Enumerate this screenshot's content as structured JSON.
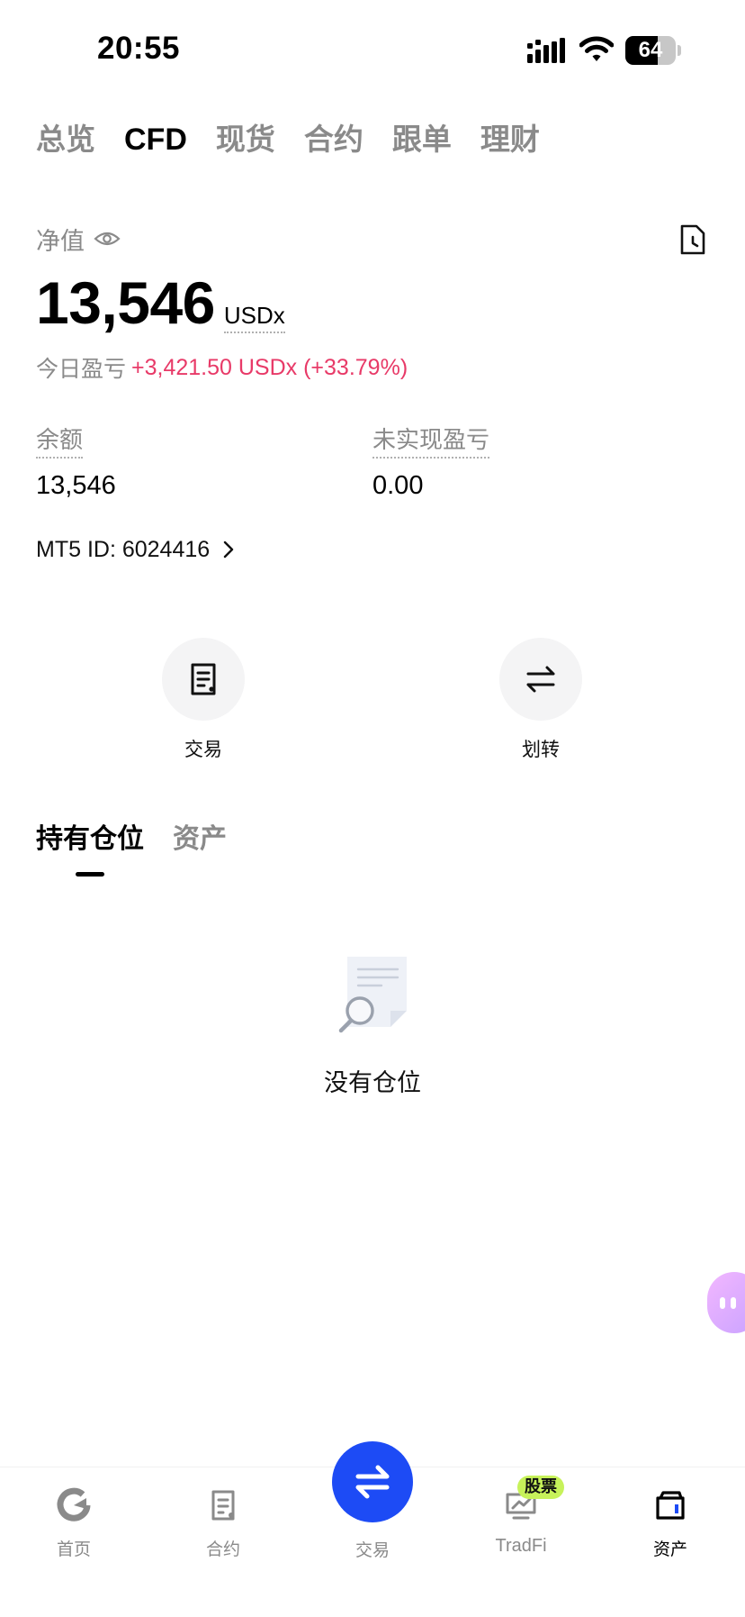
{
  "status_bar": {
    "time": "20:55",
    "battery": "64",
    "battery_level": 0.64
  },
  "top_tabs": [
    {
      "label": "总览",
      "active": false
    },
    {
      "label": "CFD",
      "active": true
    },
    {
      "label": "现货",
      "active": false
    },
    {
      "label": "合约",
      "active": false
    },
    {
      "label": "跟单",
      "active": false
    },
    {
      "label": "理财",
      "active": false
    }
  ],
  "overview": {
    "net_label": "净值",
    "net_value": "13,546",
    "net_unit": "USDx",
    "today_pnl_label": "今日盈亏",
    "today_pnl_value": "+3,421.50 USDx (+33.79%)",
    "balance_label": "余额",
    "balance_value": "13,546",
    "unrealized_label": "未实现盈亏",
    "unrealized_value": "0.00",
    "mt5_id": "MT5 ID: 6024416"
  },
  "actions": [
    {
      "label": "交易",
      "icon": "trade-doc-icon"
    },
    {
      "label": "划转",
      "icon": "transfer-arrows-icon"
    }
  ],
  "position_tabs": [
    {
      "label": "持有仓位",
      "active": true
    },
    {
      "label": "资产",
      "active": false
    }
  ],
  "empty_state": {
    "text": "没有仓位",
    "icon": "empty-search-document-icon"
  },
  "bottom_nav": {
    "items": [
      {
        "label": "首页",
        "icon": "home-logo-icon"
      },
      {
        "label": "合约",
        "icon": "contract-icon"
      },
      {
        "label": "交易",
        "icon": "swap-icon"
      },
      {
        "label": "TradFi",
        "icon": "tradfi-chart-icon",
        "badge": "股票"
      },
      {
        "label": "资产",
        "icon": "wallet-icon",
        "active": true
      }
    ]
  },
  "colors": {
    "accent_blue": "#1d4bf5",
    "pnl_red": "#e83a68",
    "badge_green": "#c7f25a",
    "muted_text": "#8a8a8a"
  }
}
